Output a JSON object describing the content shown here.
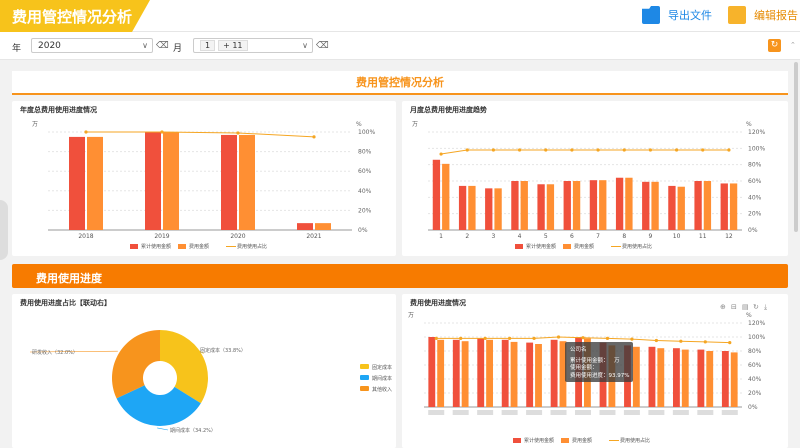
{
  "header": {
    "title": "费用管控情况分析",
    "export_label": "导出文件",
    "edit_label": "编辑报告"
  },
  "filters": {
    "year_label": "年",
    "year_value": "2020",
    "month_label": "月",
    "month_tags": [
      "1",
      "+ 11"
    ]
  },
  "section_title": "费用管控情况分析",
  "progress_section": "费用使用进度",
  "colors": {
    "budget_used": "#f0503c",
    "budget": "#ff8f33",
    "rate": "#f5a623",
    "accent": "#f7941d"
  },
  "chart_data": [
    {
      "type": "bar",
      "title": "年度总费用使用进度情况",
      "left_unit": "万",
      "right_unit": "%",
      "categories": [
        "2018",
        "2019",
        "2020",
        "2021"
      ],
      "series": [
        {
          "name": "累计使用金额",
          "values": [
            95,
            100,
            97,
            7
          ]
        },
        {
          "name": "费用金额",
          "values": [
            95,
            100,
            97,
            7
          ]
        }
      ],
      "rate": {
        "name": "费用使用占比",
        "values": [
          100,
          100,
          99,
          95
        ]
      },
      "right_ticks": [
        "100%",
        "80%",
        "60%",
        "40%",
        "20%",
        "0%"
      ],
      "ylim": [
        0,
        100
      ]
    },
    {
      "type": "bar",
      "title": "月度总费用使用进度趋势",
      "left_unit": "万",
      "right_unit": "%",
      "categories": [
        "1",
        "2",
        "3",
        "4",
        "5",
        "6",
        "7",
        "8",
        "9",
        "10",
        "11",
        "12"
      ],
      "series": [
        {
          "name": "累计使用金额",
          "values": [
            86,
            54,
            51,
            60,
            56,
            60,
            61,
            64,
            59,
            54,
            60,
            57
          ]
        },
        {
          "name": "费用金额",
          "values": [
            81,
            54,
            51,
            60,
            56,
            60,
            61,
            64,
            59,
            53,
            60,
            57
          ]
        }
      ],
      "rate": {
        "name": "费用使用占比",
        "values": [
          93,
          98,
          98,
          98,
          98,
          98,
          98,
          98,
          98,
          98,
          98,
          98
        ]
      },
      "right_ticks": [
        "120%",
        "100%",
        "80%",
        "60%",
        "40%",
        "20%",
        "0%"
      ],
      "ylim": [
        0,
        120
      ]
    },
    {
      "type": "pie",
      "title": "费用使用进度占比【联动右】",
      "slices": [
        {
          "name": "固定成本",
          "label": "固定成本（33.8%）",
          "value": 33.8,
          "color": "#f7c31b"
        },
        {
          "name": "期间成本",
          "label": "期间成本（34.2%）",
          "value": 34.2,
          "color": "#1ea6f5"
        },
        {
          "name": "其他收入",
          "label": "研发收入（32.0%）",
          "value": 32.0,
          "color": "#f7941d"
        }
      ]
    },
    {
      "type": "bar",
      "title": "费用使用进度情况",
      "left_unit": "万",
      "right_unit": "%",
      "series": [
        {
          "name": "累计使用金额",
          "values": [
            100,
            96,
            98,
            96,
            92,
            96,
            100,
            92,
            88,
            86,
            84,
            82,
            80
          ]
        },
        {
          "name": "费用金额",
          "values": [
            96,
            94,
            96,
            93,
            90,
            94,
            98,
            88,
            86,
            84,
            82,
            80,
            78
          ]
        }
      ],
      "rate": {
        "name": "费用使用占比",
        "values": [
          98,
          98,
          98,
          98,
          98,
          100,
          99,
          98,
          97,
          95,
          94,
          93,
          92
        ]
      },
      "right_ticks": [
        "120%",
        "100%",
        "80%",
        "60%",
        "40%",
        "20%",
        "0%"
      ],
      "ylim": [
        0,
        120
      ],
      "tooltip": [
        "公司名",
        "累计使用金额：",
        "万",
        "使用金额：",
        "费用使用进度：93.97%"
      ]
    }
  ]
}
